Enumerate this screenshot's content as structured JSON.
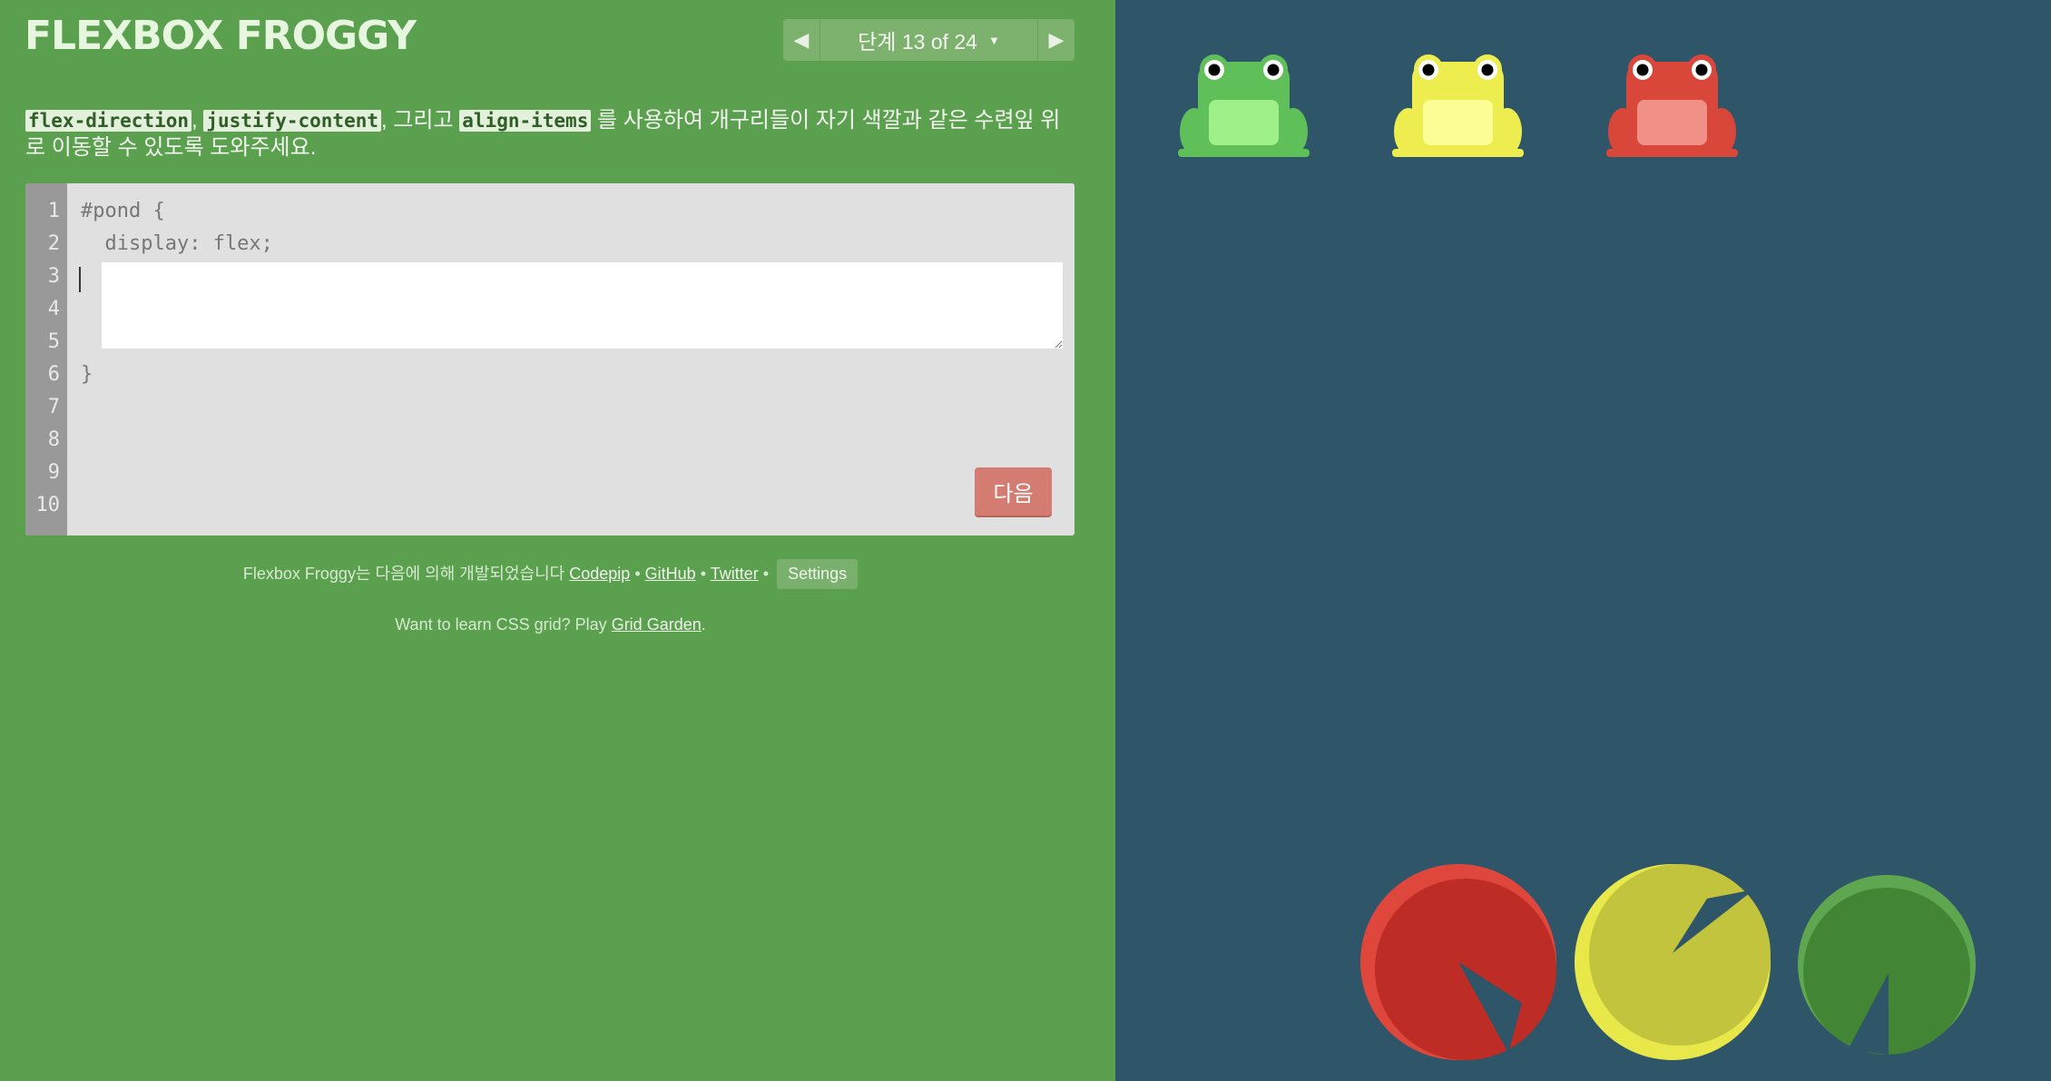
{
  "header": {
    "title": "FLEXBOX FROGGY",
    "level_label": "단계 13 of 24",
    "prev_icon": "triangle-left-icon",
    "next_icon": "triangle-right-icon"
  },
  "instructions": {
    "prop1": "flex-direction",
    "sep1": ",",
    "prop2": "justify-content",
    "text_between": ", 그리고",
    "prop3": "align-items",
    "text_end": "를 사용하여 개구리들이 자기 색깔과 같은 수련잎 위로 이동할 수 있도록 도와주세요."
  },
  "editor": {
    "line_numbers": [
      "1",
      "2",
      "3",
      "4",
      "5",
      "6",
      "7",
      "8",
      "9",
      "10"
    ],
    "line1": "#pond {",
    "line2": "  display: flex;",
    "line6": "}",
    "input_value": "",
    "next_button": "다음"
  },
  "footer": {
    "credits_text": "Flexbox Froggy는 다음에 의해 개발되었습니다",
    "codepip": "Codepip",
    "bullet": "•",
    "github": "GitHub",
    "twitter": "Twitter",
    "settings": "Settings",
    "grid_promo_text": "Want to learn CSS grid? Play",
    "grid_garden": "Grid Garden",
    "period": "."
  },
  "pond": {
    "frogs": [
      {
        "color": "green",
        "body": "#5fbf58",
        "belly": "#9ff089"
      },
      {
        "color": "yellow",
        "body": "#eded4f",
        "belly": "#fdfd95"
      },
      {
        "color": "red",
        "body": "#d9463a",
        "belly": "#f19086"
      }
    ],
    "lilypads": [
      {
        "color": "red",
        "fill": "#bd2d25",
        "rim": "#e0473c"
      },
      {
        "color": "yellow",
        "fill": "#c3c43d",
        "rim": "#e8e84a"
      },
      {
        "color": "green",
        "fill": "#418535",
        "rim": "#5ea64f"
      }
    ]
  }
}
